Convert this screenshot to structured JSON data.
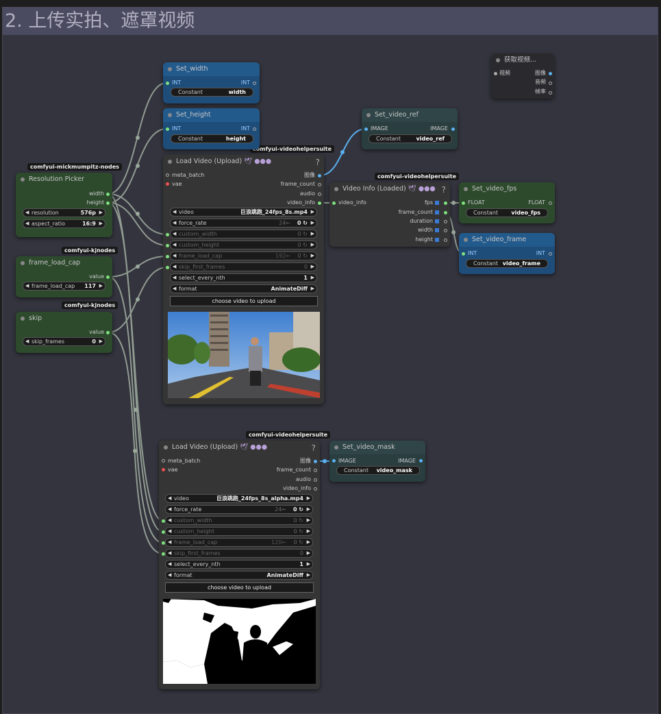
{
  "group": {
    "title": "2. 上传实拍、遮罩视频"
  },
  "tags": {
    "mick": "comfyui-mickmumpitz-nodes",
    "kj1": "comfyui-kjnodes",
    "kj2": "comfyui-kjnodes",
    "vhs1": "comfyui-videohelpersuite",
    "vhs2": "comfyui-videohelpersuite",
    "vhs3": "comfyui-videohelpersuite"
  },
  "set_width": {
    "title": "Set_width",
    "in": "INT",
    "out": "INT",
    "w_label": "Constant",
    "w_value": "width"
  },
  "set_height": {
    "title": "Set_height",
    "in": "INT",
    "out": "INT",
    "w_label": "Constant",
    "w_value": "height"
  },
  "set_video_ref": {
    "title": "Set_video_ref",
    "in": "IMAGE",
    "out": "IMAGE",
    "w_label": "Constant",
    "w_value": "video_ref"
  },
  "set_video_fps": {
    "title": "Set_video_fps",
    "in": "FLOAT",
    "out": "FLOAT",
    "w_label": "Constant",
    "w_value": "video_fps"
  },
  "set_video_frame": {
    "title": "Set_video_frame",
    "in": "INT",
    "out": "INT",
    "w_label": "Constant",
    "w_value": "video_frame"
  },
  "set_video_mask": {
    "title": "Set_video_mask",
    "in": "IMAGE",
    "out": "IMAGE",
    "w_label": "Constant",
    "w_value": "video_mask"
  },
  "get_video": {
    "title": "获取视频...",
    "in": "视频",
    "outs": [
      "图像",
      "音频",
      "帧率"
    ]
  },
  "resolution_picker": {
    "title": "Resolution Picker",
    "outs": [
      "width",
      "height"
    ],
    "w1_label": "resolution",
    "w1_value": "576p",
    "w2_label": "aspect_ratio",
    "w2_value": "16:9"
  },
  "frame_load_cap": {
    "title": "frame_load_cap",
    "out": "value",
    "w_label": "frame_load_cap",
    "w_value": "117"
  },
  "skip": {
    "title": "skip",
    "out": "value",
    "w_label": "skip_frames",
    "w_value": "0"
  },
  "video_info": {
    "title": "Video Info (Loaded)",
    "badge": "🕊 ●●●",
    "in": "video_info",
    "outs": [
      "fps",
      "frame_count",
      "duration",
      "width",
      "height"
    ]
  },
  "load1": {
    "title": "Load Video (Upload)",
    "badge": "🕊 ●●●",
    "ins": [
      "meta_batch",
      "vae"
    ],
    "outs": [
      "图像",
      "frame_count",
      "audio",
      "video_info"
    ],
    "video": "巨浪跳跑_24fps_8s.mp4",
    "force_rate_hint": "24←",
    "force_rate": "0 ↻",
    "custom_width": "0 ↻",
    "custom_height": "0 ↻",
    "frame_load_cap_hint": "192←",
    "frame_load_cap": "0 ↻",
    "skip_first_frames": "0",
    "select_every_nth": "1",
    "format": "AnimateDiff",
    "button": "choose video to upload"
  },
  "load2": {
    "title": "Load Video (Upload)",
    "badge": "🕊 ●●●",
    "ins": [
      "meta_batch",
      "vae"
    ],
    "outs": [
      "图像",
      "frame_count",
      "audio",
      "video_info"
    ],
    "video": "巨浪跳跑_24fps_8s_alpha.mp4",
    "force_rate_hint": "24←",
    "force_rate": "0 ↻",
    "custom_width": "0 ↻",
    "custom_height": "0 ↻",
    "frame_load_cap_hint": "120←",
    "frame_load_cap": "0 ↻",
    "skip_first_frames": "0",
    "select_every_nth": "1",
    "format": "AnimateDiff",
    "button": "choose video to upload"
  },
  "labels": {
    "video": "video",
    "force_rate": "force_rate",
    "custom_width": "custom_width",
    "custom_height": "custom_height",
    "frame_load_cap": "frame_load_cap",
    "skip_first_frames": "skip_first_frames",
    "select_every_nth": "select_every_nth",
    "format": "format",
    "help": "?"
  },
  "colors": {
    "link": "#9aa89a",
    "image_link": "#5ab0f0",
    "int_node": "#235a8c",
    "primitive_node": "#2d4a2d"
  }
}
